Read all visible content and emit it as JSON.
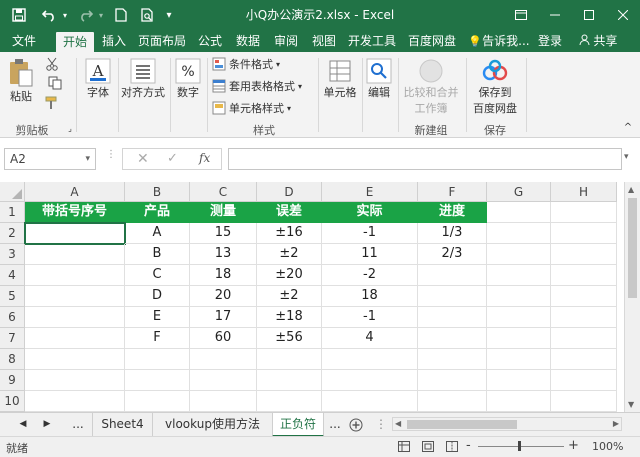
{
  "window": {
    "title": "小Q办公演示2.xlsx - Excel",
    "colors": {
      "accent": "#217346",
      "header_fill": "#1aa346"
    }
  },
  "quick_access": [
    "save-icon",
    "undo-icon",
    "redo-icon",
    "new-file-icon",
    "print-preview-icon",
    "dropdown-icon"
  ],
  "tabs": [
    {
      "label": "文件"
    },
    {
      "label": "开始"
    },
    {
      "label": "插入"
    },
    {
      "label": "页面布局"
    },
    {
      "label": "公式"
    },
    {
      "label": "数据"
    },
    {
      "label": "审阅"
    },
    {
      "label": "视图"
    },
    {
      "label": "开发工具"
    },
    {
      "label": "百度网盘"
    },
    {
      "label": "告诉我..."
    },
    {
      "label": "登录"
    },
    {
      "label": "共享"
    }
  ],
  "ribbon": {
    "paste": "粘贴",
    "clipboard_group": "剪贴板",
    "font": "字体",
    "alignment": "对齐方式",
    "number": "数字",
    "conditional_format": "条件格式",
    "format_table": "套用表格格式",
    "cell_styles": "单元格样式",
    "styles_group": "样式",
    "cells": "单元格",
    "editing": "编辑",
    "compare_merge_line1": "比较和合并",
    "compare_merge_line2": "工作簿",
    "new_group": "新建组",
    "save_to_line1": "保存到",
    "save_to_line2": "百度网盘",
    "save_group": "保存"
  },
  "formula_bar": {
    "name_box": "A2",
    "fx_label": "fx",
    "value": ""
  },
  "columns": [
    "A",
    "B",
    "C",
    "D",
    "E",
    "F",
    "G",
    "H"
  ],
  "rows": [
    "1",
    "2",
    "3",
    "4",
    "5",
    "6",
    "7",
    "8",
    "9",
    "10"
  ],
  "table": {
    "headers": [
      "带括号序号",
      "产品",
      "测量",
      "误差",
      "实际",
      "进度"
    ],
    "data": [
      [
        "",
        "A",
        "15",
        "±16",
        "-1",
        "1/3"
      ],
      [
        "",
        "B",
        "13",
        "±2",
        "11",
        "2/3"
      ],
      [
        "",
        "C",
        "18",
        "±20",
        "-2",
        ""
      ],
      [
        "",
        "D",
        "20",
        "±2",
        "18",
        ""
      ],
      [
        "",
        "E",
        "17",
        "±18",
        "-1",
        ""
      ],
      [
        "",
        "F",
        "60",
        "±56",
        "4",
        ""
      ]
    ]
  },
  "sheet_tabs": {
    "ellipsis": "...",
    "items": [
      "Sheet4",
      "vlookup使用方法",
      "正负符"
    ],
    "more": "..."
  },
  "status": {
    "ready": "就绪",
    "zoom": "100%",
    "zoom_minus": "-",
    "zoom_plus": "+"
  }
}
